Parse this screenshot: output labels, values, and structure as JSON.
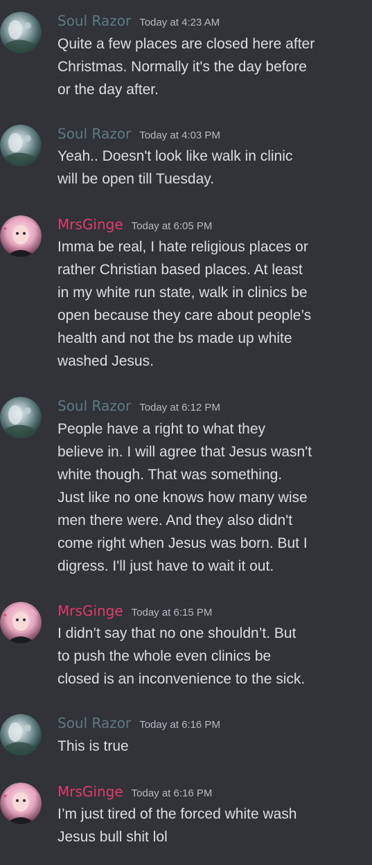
{
  "users": {
    "soul_razor": {
      "name": "Soul Razor",
      "color": "#5d7a82"
    },
    "mrsginge": {
      "name": "MrsGinge",
      "color": "#e23a6a"
    }
  },
  "messages": [
    {
      "author": "Soul Razor",
      "timestamp": "Today at 4:23 AM",
      "lines": [
        "Quite a few places are closed here after",
        "Christmas. Normally it's the day before",
        "or the day after."
      ]
    },
    {
      "author": "Soul Razor",
      "timestamp": "Today at 4:03 PM",
      "lines": [
        "Yeah.. Doesn't look like walk in clinic",
        "will be open till Tuesday."
      ]
    },
    {
      "author": "MrsGinge",
      "timestamp": "Today at 6:05 PM",
      "lines": [
        "Imma be real, I hate religious places or",
        "rather Christian based places. At least",
        "in my white run state, walk in clinics be",
        "open because they care about people’s",
        "health and not the bs made up white",
        "washed Jesus."
      ]
    },
    {
      "author": "Soul Razor",
      "timestamp": "Today at 6:12 PM",
      "lines": [
        "People have a right to what they",
        "believe in. I will agree that Jesus wasn't",
        "white though. That was something.",
        "Just like no one knows how many wise",
        "men there were. And they also didn't",
        "come right when Jesus was born. But I",
        "digress. I'll just have to wait it out."
      ]
    },
    {
      "author": "MrsGinge",
      "timestamp": "Today at 6:15 PM",
      "lines": [
        "I didn’t say that no one shouldn’t. But",
        "to push the whole even clinics be",
        "closed is an inconvenience to the sick."
      ]
    },
    {
      "author": "Soul Razor",
      "timestamp": "Today at 6:16 PM",
      "lines": [
        "This is true"
      ]
    },
    {
      "author": "MrsGinge",
      "timestamp": "Today at 6:16 PM",
      "lines": [
        "I’m just tired of the forced white wash",
        "Jesus bull shit lol"
      ]
    }
  ]
}
